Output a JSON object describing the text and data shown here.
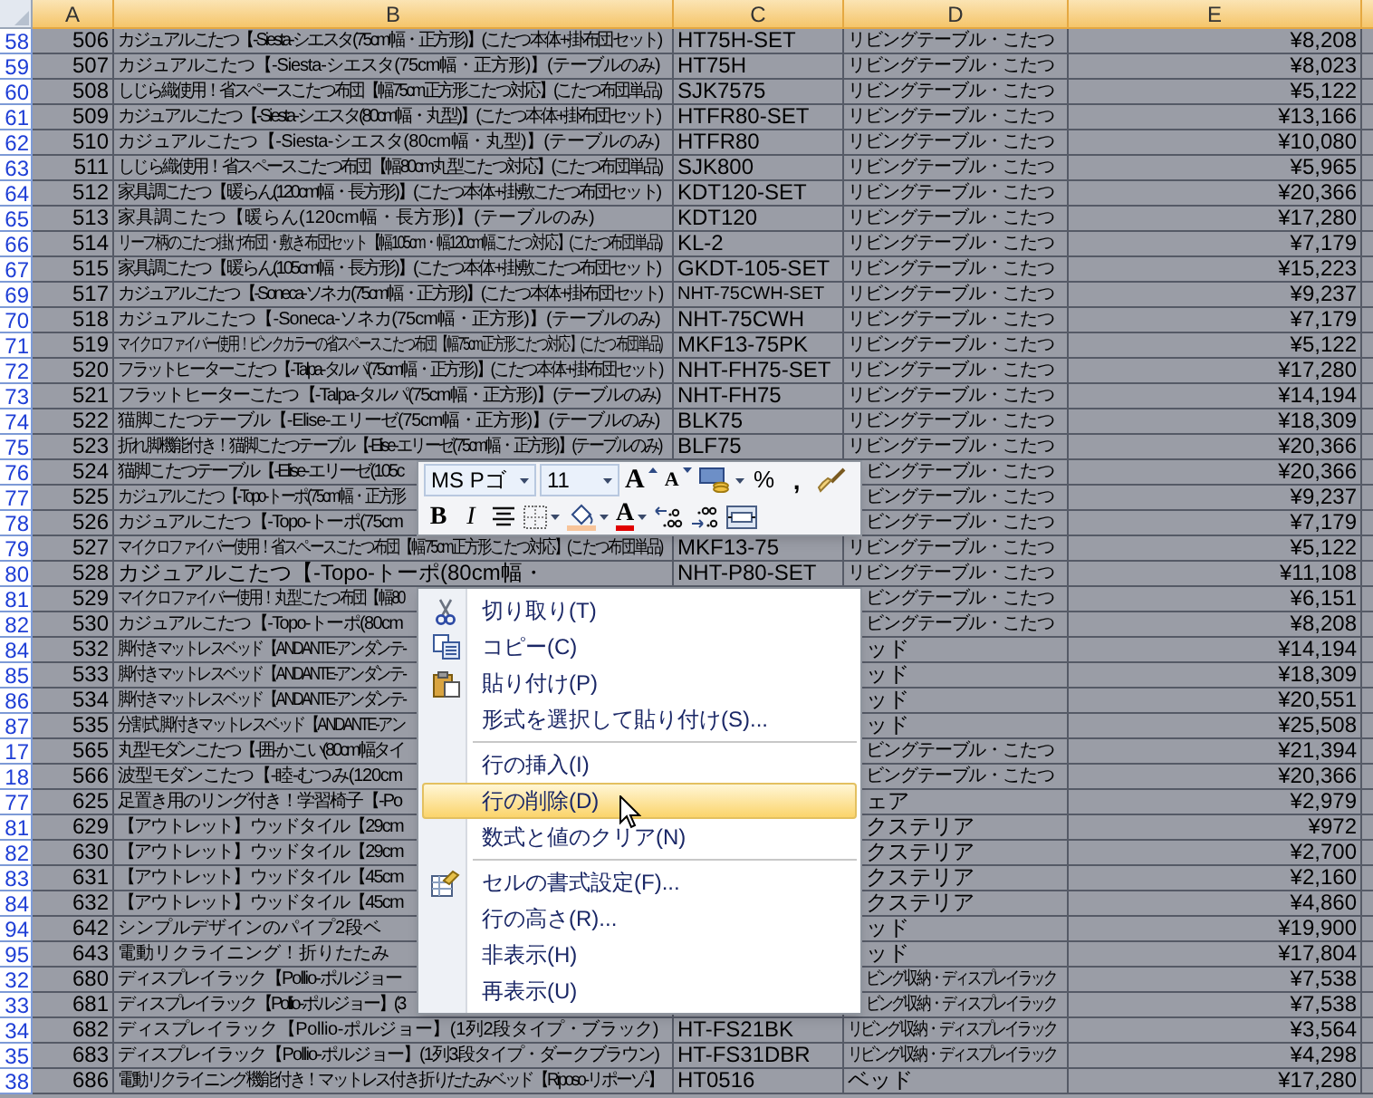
{
  "columns": [
    {
      "label": "A",
      "selected": true
    },
    {
      "label": "B",
      "selected": true
    },
    {
      "label": "C",
      "selected": true
    },
    {
      "label": "D",
      "selected": true
    },
    {
      "label": "E",
      "selected": true
    }
  ],
  "rows": [
    {
      "header": "58",
      "selected": true,
      "a": "506",
      "b": "カジュアルこたつ【-Siesta-シエスタ(75cm幅・正方形)】(こたつ本体+掛布団セット)",
      "c": "HT75H-SET",
      "d": "リビングテーブル・こたつ",
      "e": "¥8,208"
    },
    {
      "header": "59",
      "selected": true,
      "a": "507",
      "b": "カジュアルこたつ【-Siesta-シエスタ(75cm幅・正方形)】(テーブルのみ)",
      "c": "HT75H",
      "d": "リビングテーブル・こたつ",
      "e": "¥8,023"
    },
    {
      "header": "60",
      "selected": true,
      "a": "508",
      "b": "しじら織使用！省スペースこたつ布団【幅75cm正方形こたつ対応】(こたつ布団単品)",
      "c": "SJK7575",
      "d": "リビングテーブル・こたつ",
      "e": "¥5,122"
    },
    {
      "header": "61",
      "selected": true,
      "a": "509",
      "b": "カジュアルこたつ【-Siesta-シエスタ(80cm幅・丸型)】(こたつ本体+掛布団セット)",
      "c": "HTFR80-SET",
      "d": "リビングテーブル・こたつ",
      "e": "¥13,166"
    },
    {
      "header": "62",
      "selected": true,
      "a": "510",
      "b": "カジュアルこたつ【-Siesta-シエスタ(80cm幅・丸型)】(テーブルのみ)",
      "c": "HTFR80",
      "d": "リビングテーブル・こたつ",
      "e": "¥10,080"
    },
    {
      "header": "63",
      "selected": true,
      "a": "511",
      "b": "しじら織使用！省スペースこたつ布団【幅80cm丸型こたつ対応】(こたつ布団単品)",
      "c": "SJK800",
      "d": "リビングテーブル・こたつ",
      "e": "¥5,965"
    },
    {
      "header": "64",
      "selected": true,
      "a": "512",
      "b": "家具調こたつ【暖らん(120cm幅・長方形)】(こたつ本体+掛敷こたつ布団セット)",
      "c": "KDT120-SET",
      "d": "リビングテーブル・こたつ",
      "e": "¥20,366"
    },
    {
      "header": "65",
      "selected": true,
      "a": "513",
      "b": "家具調こたつ【暖らん(120cm幅・長方形)】(テーブルのみ)",
      "c": "KDT120",
      "d": "リビングテーブル・こたつ",
      "e": "¥17,280"
    },
    {
      "header": "66",
      "selected": true,
      "a": "514",
      "b": "リーフ柄のこたつ掛け布団・敷き布団セット【幅105cm・幅120cm幅こたつ対応】(こたつ布団単品)",
      "c": "KL-2",
      "d": "リビングテーブル・こたつ",
      "e": "¥7,179"
    },
    {
      "header": "67",
      "selected": true,
      "a": "515",
      "b": "家具調こたつ【暖らん(105cm幅・長方形)】(こたつ本体+掛敷こたつ布団セット)",
      "c": "GKDT-105-SET",
      "d": "リビングテーブル・こたつ",
      "e": "¥15,223"
    },
    {
      "header": "69",
      "selected": true,
      "a": "517",
      "b": "カジュアルこたつ【-Soneca-ソネカ(75cm幅・正方形)】(こたつ本体+掛布団セット)",
      "c": "NHT-75CWH-SET",
      "d": "リビングテーブル・こたつ",
      "e": "¥9,237"
    },
    {
      "header": "70",
      "selected": true,
      "a": "518",
      "b": "カジュアルこたつ【-Soneca-ソネカ(75cm幅・正方形)】(テーブルのみ)",
      "c": "NHT-75CWH",
      "d": "リビングテーブル・こたつ",
      "e": "¥7,179"
    },
    {
      "header": "71",
      "selected": true,
      "a": "519",
      "b": "マイクロファイバー使用！ピンクカラーの省スペースこたつ布団【幅75cm正方形こたつ対応】(こたつ布団単品)",
      "c": "MKF13-75PK",
      "d": "リビングテーブル・こたつ",
      "e": "¥5,122"
    },
    {
      "header": "72",
      "selected": true,
      "a": "520",
      "b": "フラットヒーターこたつ【-Talpa-タルパ(75cm幅・正方形)】(こたつ本体+掛布団セット)",
      "c": "NHT-FH75-SET",
      "d": "リビングテーブル・こたつ",
      "e": "¥17,280"
    },
    {
      "header": "73",
      "selected": true,
      "a": "521",
      "b": "フラットヒーターこたつ【-Talpa-タルパ(75cm幅・正方形)】(テーブルのみ)",
      "c": "NHT-FH75",
      "d": "リビングテーブル・こたつ",
      "e": "¥14,194"
    },
    {
      "header": "74",
      "selected": true,
      "a": "522",
      "b": "猫脚こたつテーブル【-Elise-エリーゼ(75cm幅・正方形)】(テーブルのみ)",
      "c": "BLK75",
      "d": "リビングテーブル・こたつ",
      "e": "¥18,309"
    },
    {
      "header": "75",
      "selected": true,
      "a": "523",
      "b": "折れ脚機能付き！猫脚こたつテーブル【-Elise-エリーゼ(75cm幅・正方形)】(テーブルのみ)",
      "c": "BLF75",
      "d": "リビングテーブル・こたつ",
      "e": "¥20,366"
    },
    {
      "header": "76",
      "selected": true,
      "a": "524",
      "b": "猫脚こたつテーブル【-Elise-エリーゼ(105c",
      "d": "ビングテーブル・こたつ",
      "e": "¥20,366"
    },
    {
      "header": "77",
      "selected": true,
      "a": "525",
      "b": "カジュアルこたつ【-Topo-トーポ(75cm幅・正方形",
      "d": "ビングテーブル・こたつ",
      "e": "¥9,237"
    },
    {
      "header": "78",
      "selected": true,
      "a": "526",
      "b": "カジュアルこたつ【-Topo-トーポ(75cm",
      "d": "ビングテーブル・こたつ",
      "e": "¥7,179"
    },
    {
      "header": "79",
      "selected": true,
      "a": "527",
      "b": "マイクロファイバー使用！省スペースこたつ布団【幅75cm正方形こたつ対応】(こたつ布団単品)",
      "c": "MKF13-75",
      "d": "リビングテーブル・こたつ",
      "e": "¥5,122"
    },
    {
      "header": "80",
      "selected": true,
      "a": "528",
      "b": "カジュアルこたつ【-Topo-トーポ(80cm幅・",
      "c": "NHT-P80-SET",
      "d": "リビングテーブル・こたつ",
      "e": "¥11,108"
    },
    {
      "header": "81",
      "selected": true,
      "a": "529",
      "b": "マイクロファイバー使用！丸型こたつ布団【幅80",
      "d": "ビングテーブル・こたつ",
      "e": "¥6,151"
    },
    {
      "header": "82",
      "selected": true,
      "a": "530",
      "b": "カジュアルこたつ【-Topo-トーポ(80cm",
      "d": "ビングテーブル・こたつ",
      "e": "¥8,208"
    },
    {
      "header": "84",
      "selected": true,
      "a": "532",
      "b": "脚付きマットレスベッド【ANDANTE-アンダンテ-",
      "d": "ッド",
      "e": "¥14,194"
    },
    {
      "header": "85",
      "selected": true,
      "a": "533",
      "b": "脚付きマットレスベッド【ANDANTE-アンダンテ-",
      "d": "ッド",
      "e": "¥18,309"
    },
    {
      "header": "86",
      "selected": true,
      "a": "534",
      "b": "脚付きマットレスベッド【ANDANTE-アンダンテ-",
      "d": "ッド",
      "e": "¥20,551"
    },
    {
      "header": "87",
      "selected": true,
      "a": "535",
      "b": "分割式 脚付きマットレスベッド【ANDANTE-アン",
      "d": "ッド",
      "e": "¥25,508"
    },
    {
      "header": "17",
      "selected": true,
      "a": "565",
      "b": "丸型モダンこたつ【-囲-かこい(80cm幅タイ",
      "d": "ビングテーブル・こたつ",
      "e": "¥21,394"
    },
    {
      "header": "18",
      "selected": true,
      "a": "566",
      "b": "波型モダンこたつ【-睦-むつみ(120cm",
      "d": "ビングテーブル・こたつ",
      "e": "¥20,366"
    },
    {
      "header": "77",
      "selected": true,
      "a": "625",
      "b": "足置き用のリング付き！学習椅子【-Po",
      "d": "ェア",
      "e": "¥2,979"
    },
    {
      "header": "81",
      "selected": true,
      "a": "629",
      "b": "【アウトレット】ウッドタイル【29cm",
      "d": "クステリア",
      "e": "¥972"
    },
    {
      "header": "82",
      "selected": true,
      "a": "630",
      "b": "【アウトレット】ウッドタイル【29cm",
      "d": "クステリア",
      "e": "¥2,700"
    },
    {
      "header": "83",
      "selected": true,
      "a": "631",
      "b": "【アウトレット】ウッドタイル【45cm",
      "d": "クステリア",
      "e": "¥2,160"
    },
    {
      "header": "84",
      "selected": true,
      "a": "632",
      "b": "【アウトレット】ウッドタイル【45cm",
      "d": "クステリア",
      "e": "¥4,860"
    },
    {
      "header": "94",
      "selected": true,
      "a": "642",
      "b": "シンプルデザインのパイプ2段ベ",
      "d": "ッド",
      "e": "¥19,900"
    },
    {
      "header": "95",
      "selected": true,
      "a": "643",
      "b": "電動リクライニング！折りたたみ",
      "d": "ッド",
      "e": "¥17,804"
    },
    {
      "header": "32",
      "selected": true,
      "a": "680",
      "b": "ディスプレイラック【Pollio-ポルジョー",
      "d": "ビング収納・ディスプレイラック",
      "e": "¥7,538"
    },
    {
      "header": "33",
      "selected": true,
      "a": "681",
      "b": "ディスプレイラック【Pollio-ポルジョー】(3",
      "d": "ビング収納・ディスプレイラック",
      "e": "¥7,538"
    },
    {
      "header": "34",
      "selected": true,
      "a": "682",
      "b": "ディスプレイラック【Pollio-ポルジョー】(1列2段タイプ・ブラック)",
      "c": "HT-FS21BK",
      "d": "リビング収納・ディスプレイラック",
      "e": "¥3,564"
    },
    {
      "header": "35",
      "selected": true,
      "a": "683",
      "b": "ディスプレイラック【Pollio-ポルジョー】(1列3段タイプ・ダークブラウン)",
      "c": "HT-FS31DBR",
      "d": "リビング収納・ディスプレイラック",
      "e": "¥4,298"
    },
    {
      "header": "38",
      "selected": true,
      "a": "686",
      "b": "電動リクライニング機能付き！マットレス付き折りたたみベッド【Riposo-リポーゾ-】",
      "c": "HT0516",
      "d": "ベッド",
      "e": "¥17,280"
    }
  ],
  "mini_toolbar": {
    "font": "MS Pゴ",
    "size": "11",
    "buttons": [
      [
        {
          "kind": "grow-font",
          "label": "A",
          "dropdown": false
        },
        {
          "kind": "shrink-font",
          "label": "A",
          "dropdown": false
        },
        {
          "kind": "accounting",
          "dropdown": true
        },
        {
          "kind": "percent",
          "label": "%",
          "dropdown": false
        },
        {
          "kind": "comma",
          "label": ",",
          "dropdown": false
        },
        {
          "kind": "painter",
          "dropdown": false
        }
      ],
      [
        {
          "kind": "bold",
          "label": "B",
          "dropdown": false
        },
        {
          "kind": "italic",
          "label": "I",
          "dropdown": false
        },
        {
          "kind": "center",
          "dropdown": false
        },
        {
          "kind": "borders",
          "dropdown": true
        },
        {
          "kind": "fill",
          "dropdown": true
        },
        {
          "kind": "font-color",
          "label": "A",
          "dropdown": true
        },
        {
          "kind": "inc-decimal",
          "dropdown": false
        },
        {
          "kind": "dec-decimal",
          "dropdown": false
        },
        {
          "kind": "merge",
          "dropdown": false
        }
      ]
    ]
  },
  "context_menu": [
    {
      "kind": "cut",
      "label": "切り取り(T)",
      "selected": false
    },
    {
      "kind": "copy",
      "label": "コピー(C)",
      "selected": false
    },
    {
      "kind": "paste",
      "label": "貼り付け(P)",
      "selected": false
    },
    {
      "kind": "plain",
      "label": "形式を選択して貼り付け(S)...",
      "selected": false
    },
    {
      "kind": "separator"
    },
    {
      "kind": "plain",
      "label": "行の挿入(I)",
      "selected": false
    },
    {
      "kind": "plain",
      "label": "行の削除(D)",
      "selected": true
    },
    {
      "kind": "plain",
      "label": "数式と値のクリア(N)",
      "selected": false
    },
    {
      "kind": "separator"
    },
    {
      "kind": "format",
      "label": "セルの書式設定(F)...",
      "selected": false
    },
    {
      "kind": "plain",
      "label": "行の高さ(R)...",
      "selected": false
    },
    {
      "kind": "plain",
      "label": "非表示(H)",
      "selected": false
    },
    {
      "kind": "plain",
      "label": "再表示(U)",
      "selected": false
    }
  ]
}
